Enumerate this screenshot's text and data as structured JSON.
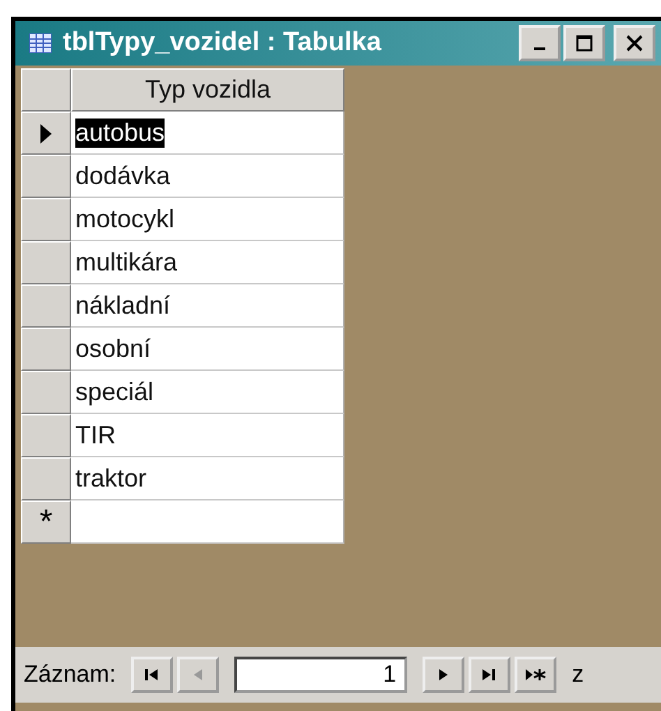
{
  "window": {
    "title": "tblTypy_vozidel : Tabulka"
  },
  "table": {
    "columns": [
      "Typ vozidla"
    ],
    "rows": [
      {
        "value": "autobus",
        "selected": true
      },
      {
        "value": "dodávka",
        "selected": false
      },
      {
        "value": "motocykl",
        "selected": false
      },
      {
        "value": "multikára",
        "selected": false
      },
      {
        "value": "nákladní",
        "selected": false
      },
      {
        "value": "osobní",
        "selected": false
      },
      {
        "value": "speciál",
        "selected": false
      },
      {
        "value": "TIR",
        "selected": false
      },
      {
        "value": "traktor",
        "selected": false
      }
    ],
    "new_row_marker": "*"
  },
  "navigation": {
    "label": "Záznam:",
    "buttons": [
      {
        "kind": "first",
        "disabled": false
      },
      {
        "kind": "prev",
        "disabled": true
      }
    ],
    "record": "1",
    "buttons_after": [
      {
        "kind": "next",
        "disabled": false
      },
      {
        "kind": "last",
        "disabled": false
      },
      {
        "kind": "new",
        "disabled": false
      }
    ],
    "trailing": "z"
  }
}
